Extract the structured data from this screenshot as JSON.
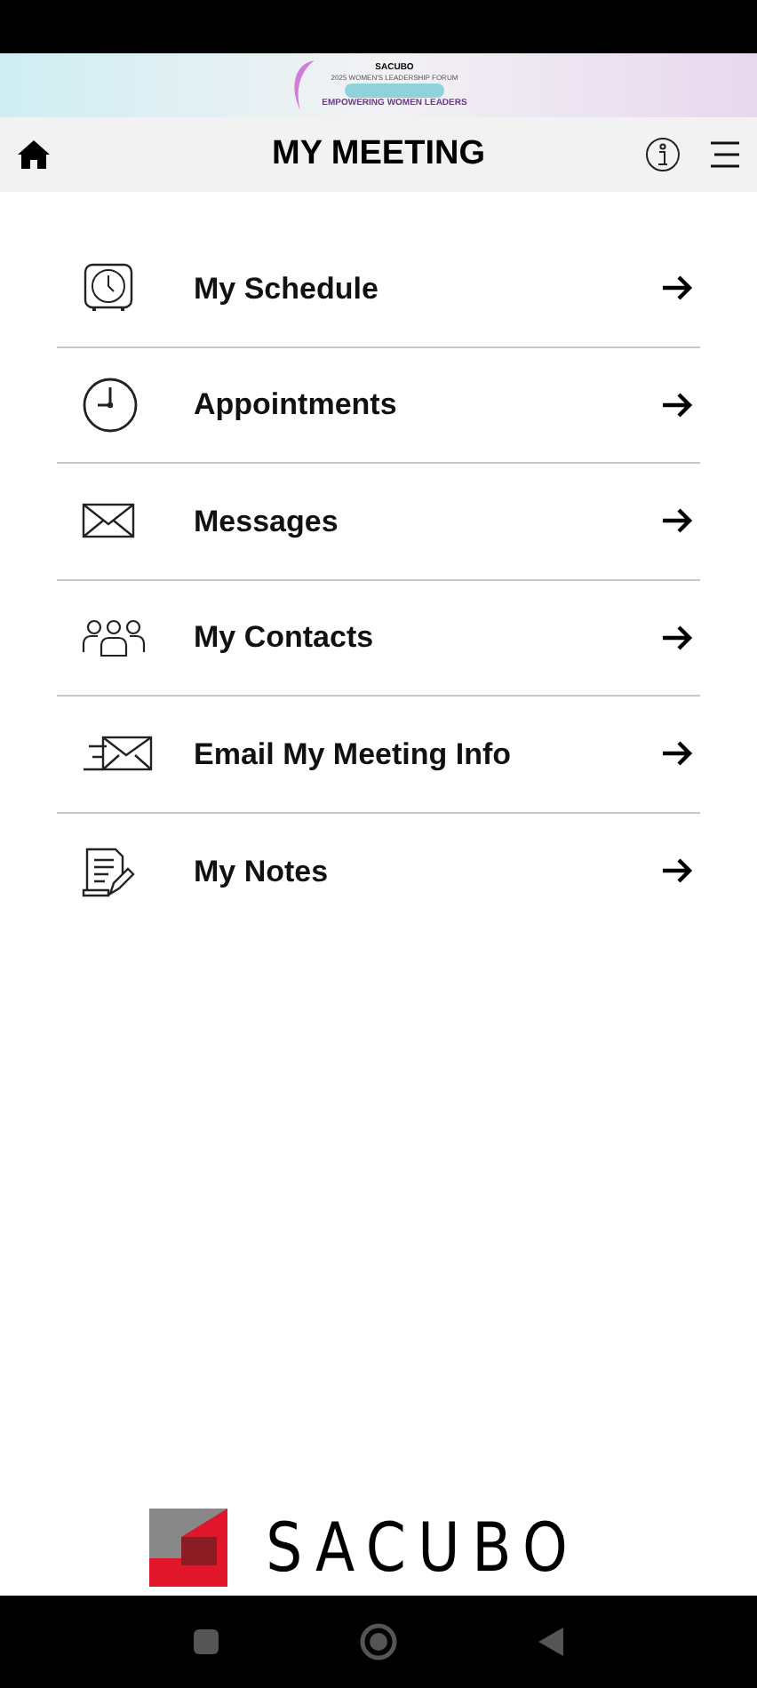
{
  "banner": {
    "brand": "SACUBO",
    "event": "2025 WOMEN'S LEADERSHIP FORUM",
    "tagline": "EMPOWERING WOMEN LEADERS"
  },
  "header": {
    "title": "MY MEETING"
  },
  "menu": [
    {
      "label": "My Schedule"
    },
    {
      "label": "Appointments"
    },
    {
      "label": "Messages"
    },
    {
      "label": "My Contacts"
    },
    {
      "label": "Email My Meeting Info"
    },
    {
      "label": "My Notes"
    }
  ],
  "footer": {
    "logo_text": "SACUBO"
  }
}
